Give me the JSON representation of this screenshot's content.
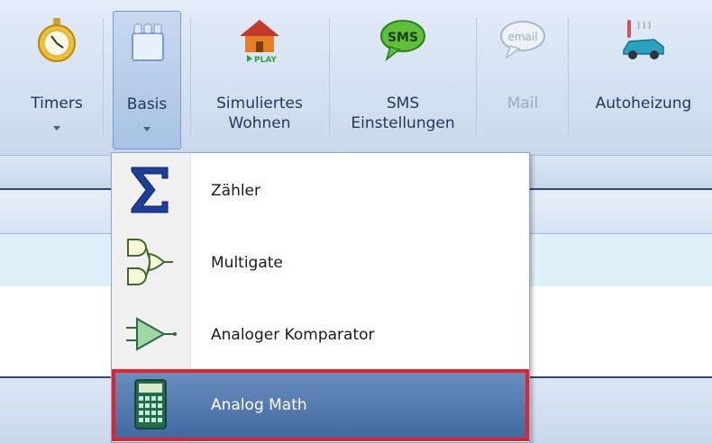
{
  "ribbon": {
    "buttons": [
      {
        "label": "Timers",
        "icon": "stopwatch-icon",
        "has_dropdown": true
      },
      {
        "label": "Basis",
        "icon": "building-blocks-icon",
        "has_dropdown": true,
        "pressed": true
      },
      {
        "label": "Simuliertes\nWohnen",
        "icon": "house-play-icon",
        "badge": "PLAY"
      },
      {
        "label": "SMS\nEinstellungen",
        "icon": "sms-bubble-icon",
        "badge": "SMS"
      },
      {
        "label": "Mail",
        "icon": "email-bubble-icon",
        "badge": "email",
        "disabled": true
      },
      {
        "label": "Autoheizung",
        "icon": "car-heater-icon"
      }
    ]
  },
  "dropdown": {
    "items": [
      {
        "label": "Zähler",
        "icon": "sigma-icon"
      },
      {
        "label": "Multigate",
        "icon": "logic-gates-icon"
      },
      {
        "label": "Analoger Komparator",
        "icon": "comparator-icon"
      },
      {
        "label": "Analog Math",
        "icon": "calculator-icon",
        "highlighted": true
      }
    ]
  },
  "colors": {
    "highlight_outline": "#e0242f",
    "highlight_fill": "#4f76ad",
    "ribbon_text": "#1e395b"
  }
}
